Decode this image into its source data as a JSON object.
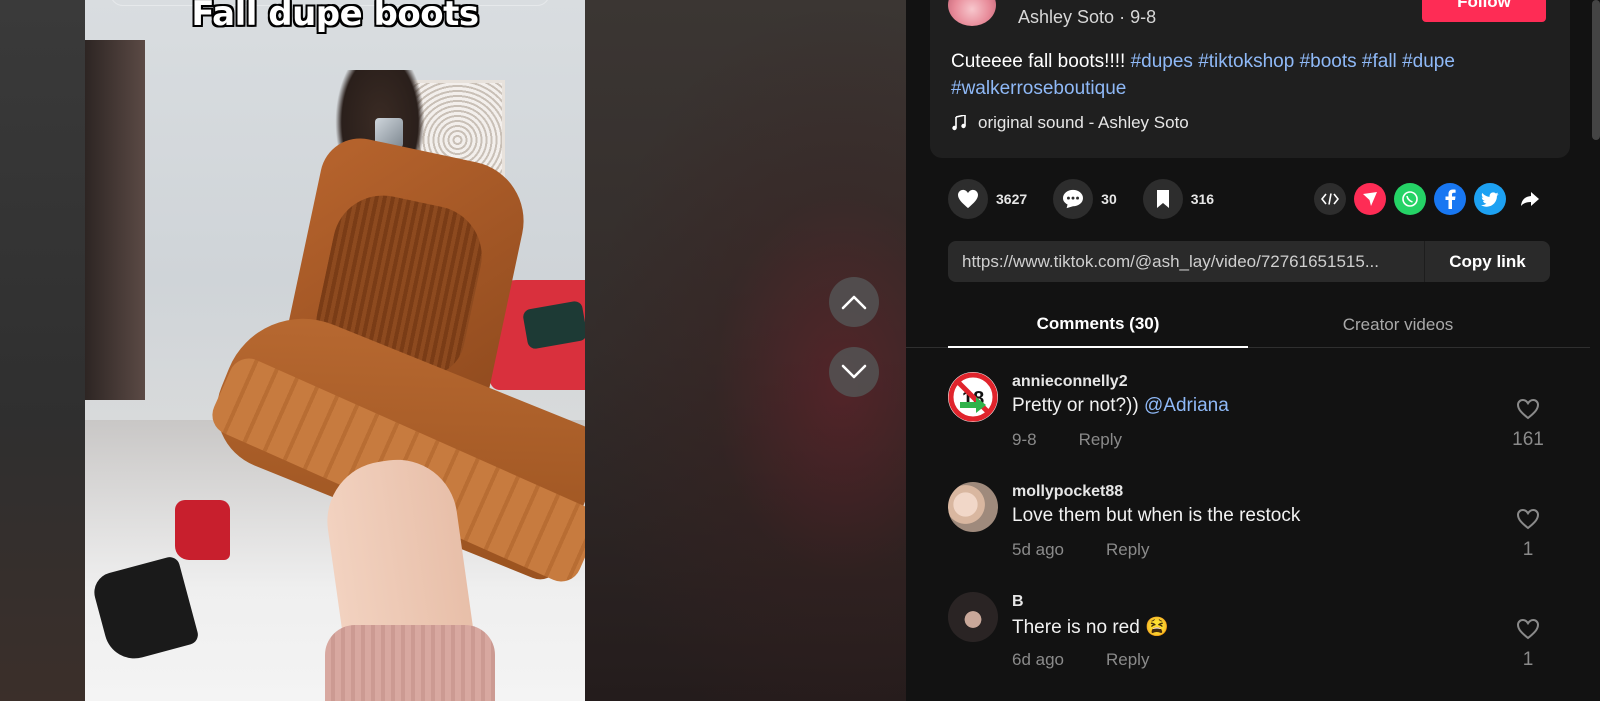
{
  "video": {
    "title": "Fall dupe boots"
  },
  "author": {
    "name": "Ashley Soto",
    "date": "9-8",
    "follow_label": "Follow"
  },
  "description": {
    "text": "Cuteeee fall boots!!!!",
    "hashtags": [
      "#dupes",
      "#tiktokshop",
      "#boots",
      "#fall",
      "#dupe",
      "#walkerroseboutique"
    ],
    "sound": "original sound - Ashley Soto"
  },
  "actions": {
    "likes": "3627",
    "comments": "30",
    "saves": "316"
  },
  "share": {
    "link": "https://www.tiktok.com/@ash_lay/video/72761651515...",
    "copy_label": "Copy link"
  },
  "tabs": {
    "comments": "Comments (30)",
    "creator": "Creator videos"
  },
  "comments": [
    {
      "user": "annieconnelly2",
      "text": "Pretty or not?))",
      "mention": "@Adriana",
      "date": "9-8",
      "reply": "Reply",
      "likes": "161"
    },
    {
      "user": "mollypocket88",
      "text": "Love them but when is the restock",
      "mention": "",
      "date": "5d ago",
      "reply": "Reply",
      "likes": "1"
    },
    {
      "user": "B",
      "text": "There is no red 😫",
      "mention": "",
      "date": "6d ago",
      "reply": "Reply",
      "likes": "1"
    }
  ],
  "colors": {
    "accent": "#fe2c55",
    "hashtag": "#8fb9f7",
    "panel_bg": "#121212"
  }
}
